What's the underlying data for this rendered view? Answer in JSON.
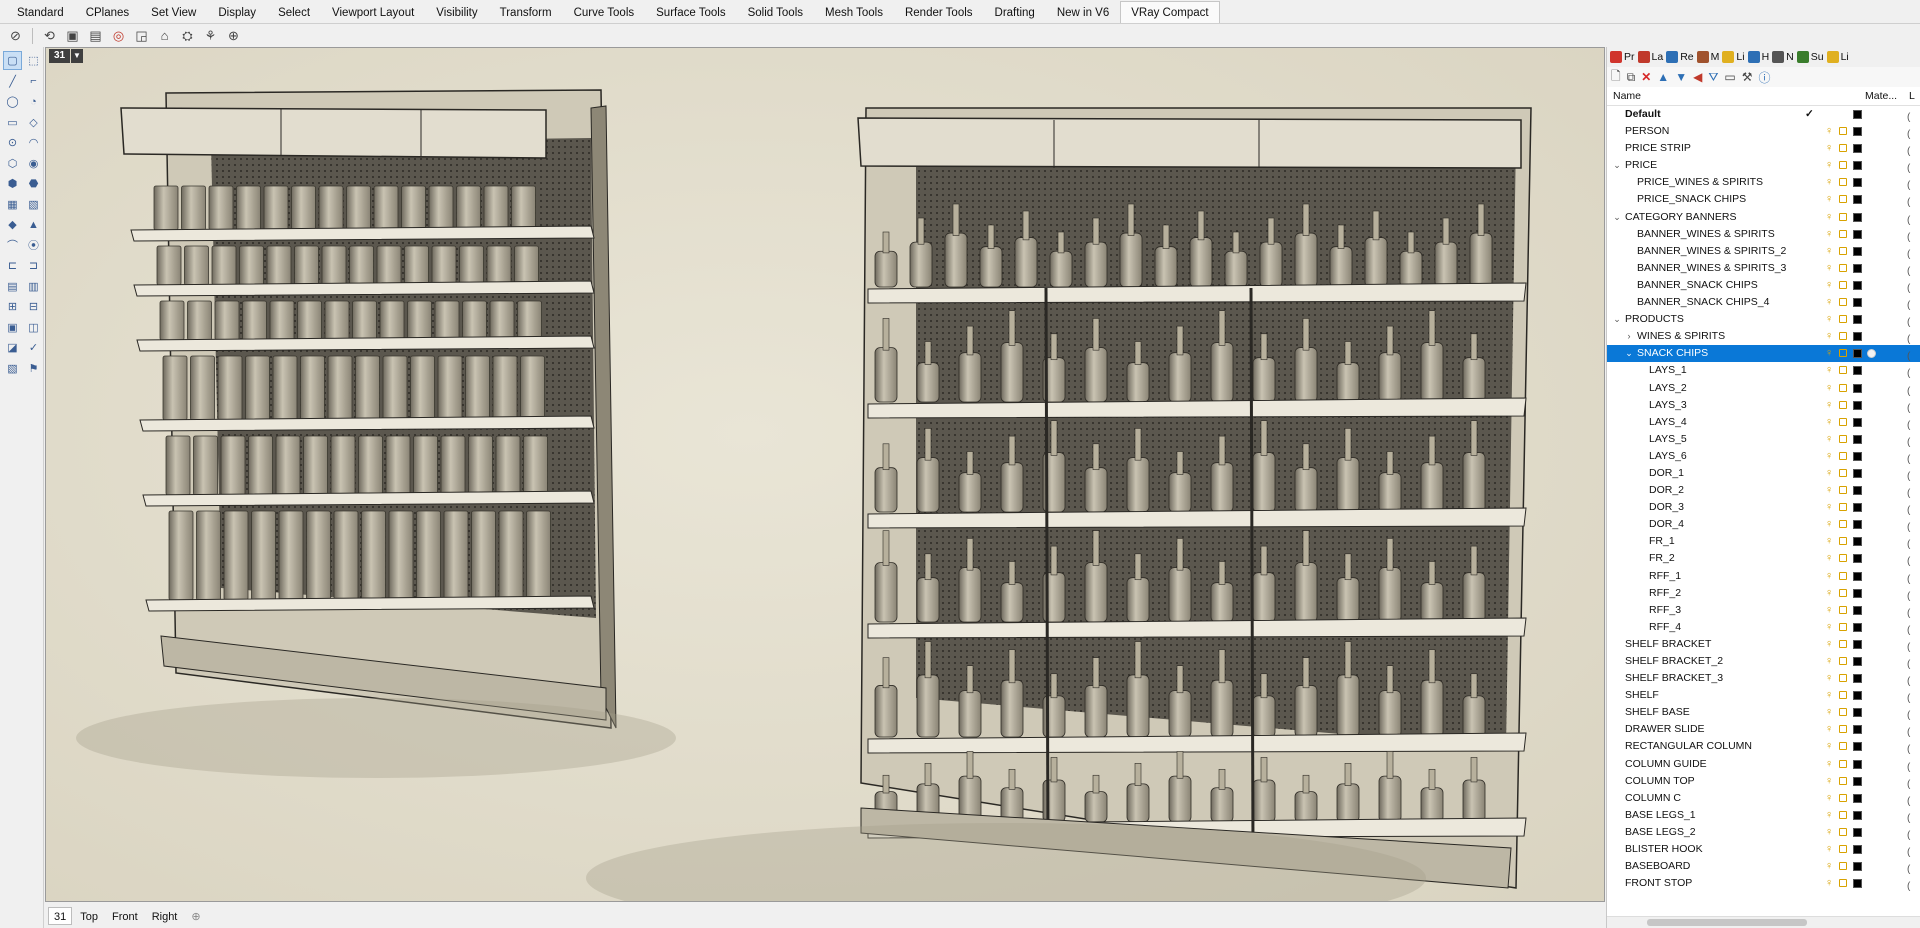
{
  "tabs": [
    "Standard",
    "CPlanes",
    "Set View",
    "Display",
    "Select",
    "Viewport Layout",
    "Visibility",
    "Transform",
    "Curve Tools",
    "Surface Tools",
    "Solid Tools",
    "Mesh Tools",
    "Render Tools",
    "Drafting",
    "New in V6",
    "VRay Compact"
  ],
  "active_tab": "VRay Compact",
  "viewport": {
    "number": "31"
  },
  "view_tabs": [
    "31",
    "Top",
    "Front",
    "Right"
  ],
  "panel": {
    "tabs": [
      {
        "label": "Pr",
        "color": "#d0342c"
      },
      {
        "label": "La",
        "color": "#c0392b"
      },
      {
        "label": "Re",
        "color": "#2d6fb5"
      },
      {
        "label": "M",
        "color": "#a0522d"
      },
      {
        "label": "Li",
        "color": "#e0b020"
      },
      {
        "label": "H",
        "color": "#2d6fb5"
      },
      {
        "label": "N",
        "color": "#555555"
      },
      {
        "label": "Su",
        "color": "#3a7d2c"
      },
      {
        "label": "Li",
        "color": "#e0b020"
      }
    ],
    "header": {
      "name": "Name",
      "material": "Mate...",
      "linetype": "L"
    },
    "layers": [
      {
        "name": "Default",
        "level": 0,
        "bold": true,
        "check": true
      },
      {
        "name": "PERSON",
        "level": 0
      },
      {
        "name": "PRICE STRIP",
        "level": 0
      },
      {
        "name": "PRICE",
        "level": 0,
        "expander": "v"
      },
      {
        "name": "PRICE_WINES & SPIRITS",
        "level": 1
      },
      {
        "name": "PRICE_SNACK CHIPS",
        "level": 1
      },
      {
        "name": "CATEGORY BANNERS",
        "level": 0,
        "expander": "v"
      },
      {
        "name": "BANNER_WINES & SPIRITS",
        "level": 1
      },
      {
        "name": "BANNER_WINES & SPIRITS_2",
        "level": 1
      },
      {
        "name": "BANNER_WINES & SPIRITS_3",
        "level": 1
      },
      {
        "name": "BANNER_SNACK CHIPS",
        "level": 1
      },
      {
        "name": "BANNER_SNACK CHIPS_4",
        "level": 1
      },
      {
        "name": "PRODUCTS",
        "level": 0,
        "expander": "v"
      },
      {
        "name": "WINES & SPIRITS",
        "level": 1,
        "expander": ">"
      },
      {
        "name": "SNACK CHIPS",
        "level": 1,
        "expander": "v",
        "selected": true
      },
      {
        "name": "LAYS_1",
        "level": 2
      },
      {
        "name": "LAYS_2",
        "level": 2
      },
      {
        "name": "LAYS_3",
        "level": 2
      },
      {
        "name": "LAYS_4",
        "level": 2
      },
      {
        "name": "LAYS_5",
        "level": 2
      },
      {
        "name": "LAYS_6",
        "level": 2
      },
      {
        "name": "DOR_1",
        "level": 2
      },
      {
        "name": "DOR_2",
        "level": 2
      },
      {
        "name": "DOR_3",
        "level": 2
      },
      {
        "name": "DOR_4",
        "level": 2
      },
      {
        "name": "FR_1",
        "level": 2
      },
      {
        "name": "FR_2",
        "level": 2
      },
      {
        "name": "RFF_1",
        "level": 2
      },
      {
        "name": "RFF_2",
        "level": 2
      },
      {
        "name": "RFF_3",
        "level": 2
      },
      {
        "name": "RFF_4",
        "level": 2
      },
      {
        "name": "SHELF BRACKET",
        "level": 0
      },
      {
        "name": "SHELF BRACKET_2",
        "level": 0
      },
      {
        "name": "SHELF BRACKET_3",
        "level": 0
      },
      {
        "name": "SHELF",
        "level": 0
      },
      {
        "name": "SHELF BASE",
        "level": 0
      },
      {
        "name": "DRAWER SLIDE",
        "level": 0
      },
      {
        "name": "RECTANGULAR COLUMN",
        "level": 0
      },
      {
        "name": "COLUMN GUIDE",
        "level": 0
      },
      {
        "name": "COLUMN TOP",
        "level": 0
      },
      {
        "name": "COLUMN C",
        "level": 0
      },
      {
        "name": "BASE LEGS_1",
        "level": 0
      },
      {
        "name": "BASE LEGS_2",
        "level": 0
      },
      {
        "name": "BLISTER HOOK",
        "level": 0
      },
      {
        "name": "BASEBOARD",
        "level": 0
      },
      {
        "name": "FRONT STOP",
        "level": 0
      }
    ]
  }
}
